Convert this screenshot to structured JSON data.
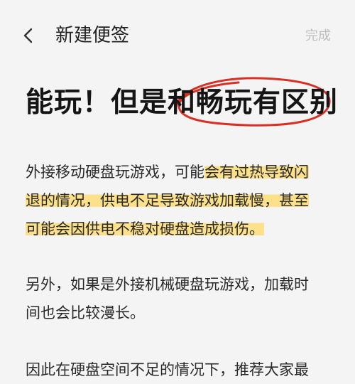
{
  "header": {
    "title": "新建便签",
    "done_label": "完成",
    "back_icon": "chevron-left-icon"
  },
  "note": {
    "headline_plain": "能玩！但是",
    "headline_circled": "和畅玩有区别",
    "paragraphs": [
      {
        "lines": [
          {
            "plain": "外接移动硬盘玩游戏，可能",
            "highlight": "会有过热导致闪"
          },
          {
            "plain": "",
            "highlight": "退的情况，供电不足导致游戏加载慢，甚至"
          },
          {
            "plain": "",
            "highlight": "可能会因供电不稳对硬盘造成损伤。"
          }
        ]
      },
      {
        "lines": [
          {
            "plain": "另外，如果是外接机械硬盘玩游戏，加载时"
          },
          {
            "plain": "间也会比较漫长。"
          }
        ]
      },
      {
        "lines": [
          {
            "plain": "因此在硬盘空间不足的情况下，推荐大家最"
          }
        ]
      }
    ]
  },
  "colors": {
    "highlight": "#fce08a",
    "circle": "#d93025",
    "done_text": "#bdbdbd",
    "background": "#f4f4f4"
  }
}
